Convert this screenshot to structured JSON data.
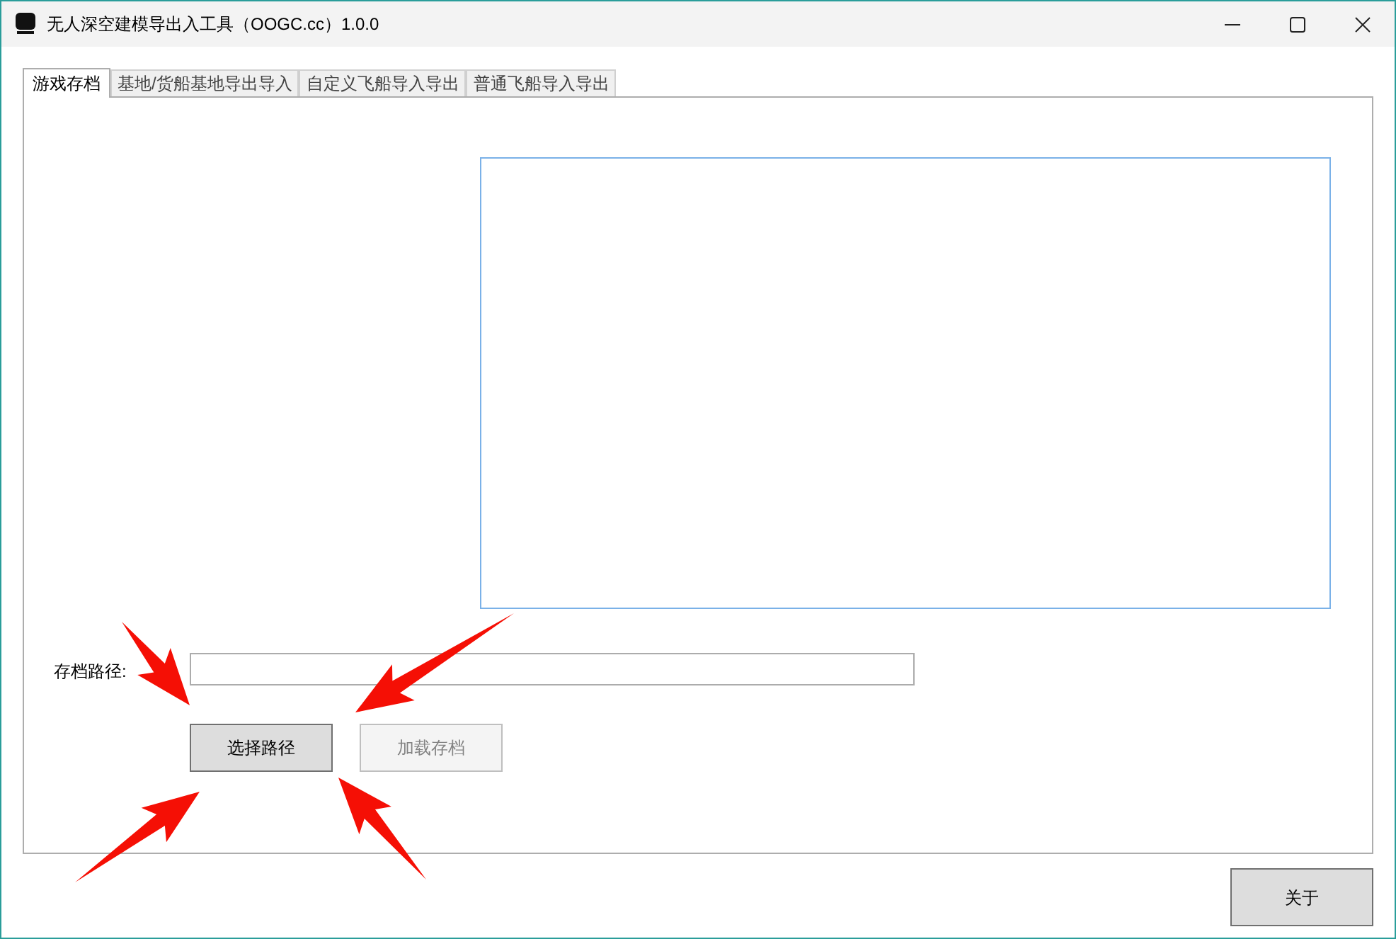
{
  "window": {
    "title": "无人深空建模导出入工具（OOGC.cc）1.0.0"
  },
  "tabs": [
    {
      "label": "游戏存档",
      "selected": true
    },
    {
      "label": "基地/货船基地导出导入",
      "selected": false
    },
    {
      "label": "自定义飞船导入导出",
      "selected": false
    },
    {
      "label": "普通飞船导入导出",
      "selected": false
    }
  ],
  "save_path": {
    "label": "存档路径:"
  },
  "buttons": [
    {
      "label": "选择路径",
      "disabled": false
    },
    {
      "label": "加载存档",
      "disabled": true
    }
  ],
  "about_button": {
    "label": "关于"
  }
}
